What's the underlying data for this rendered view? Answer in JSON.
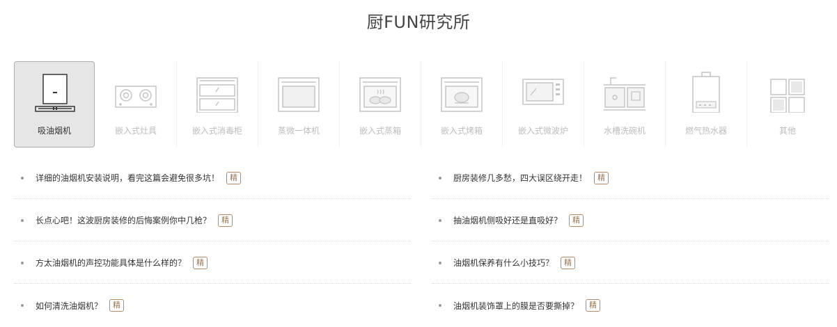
{
  "page": {
    "title": "厨FUN研究所"
  },
  "categories": [
    {
      "label": "吸油烟机",
      "icon": "range-hood-icon",
      "active": true
    },
    {
      "label": "嵌入式灶具",
      "icon": "gas-stove-icon",
      "active": false
    },
    {
      "label": "嵌入式消毒柜",
      "icon": "disinfection-cabinet-icon",
      "active": false
    },
    {
      "label": "蒸微一体机",
      "icon": "steam-microwave-combo-icon",
      "active": false
    },
    {
      "label": "嵌入式蒸箱",
      "icon": "steam-oven-icon",
      "active": false
    },
    {
      "label": "嵌入式烤箱",
      "icon": "oven-icon",
      "active": false
    },
    {
      "label": "嵌入式微波炉",
      "icon": "microwave-icon",
      "active": false
    },
    {
      "label": "水槽洗碗机",
      "icon": "sink-dishwasher-icon",
      "active": false
    },
    {
      "label": "燃气热水器",
      "icon": "water-heater-icon",
      "active": false
    },
    {
      "label": "其他",
      "icon": "others-grid-icon",
      "active": false
    }
  ],
  "articles": {
    "left": [
      {
        "title": "详细的油烟机安装说明，看完这篇会避免很多坑！",
        "tag": "精"
      },
      {
        "title": "长点心吧！这波厨房装修的后悔案例你中几枪？",
        "tag": "精"
      },
      {
        "title": "方太油烟机的声控功能具体是什么样的？",
        "tag": "精"
      },
      {
        "title": "如何清洗油烟机？",
        "tag": "精"
      }
    ],
    "right": [
      {
        "title": "厨房装修几多愁，四大误区绕开走！",
        "tag": "精"
      },
      {
        "title": "抽油烟机侧吸好还是直吸好？",
        "tag": "精"
      },
      {
        "title": "油烟机保养有什么小技巧？",
        "tag": "精"
      },
      {
        "title": "油烟机装饰罩上的膜是否要撕掉？",
        "tag": "精"
      }
    ]
  },
  "colors": {
    "accent_tag": "#a0764b",
    "active_bg": "#e6e6e6",
    "inactive_label": "#bdbdbd"
  }
}
